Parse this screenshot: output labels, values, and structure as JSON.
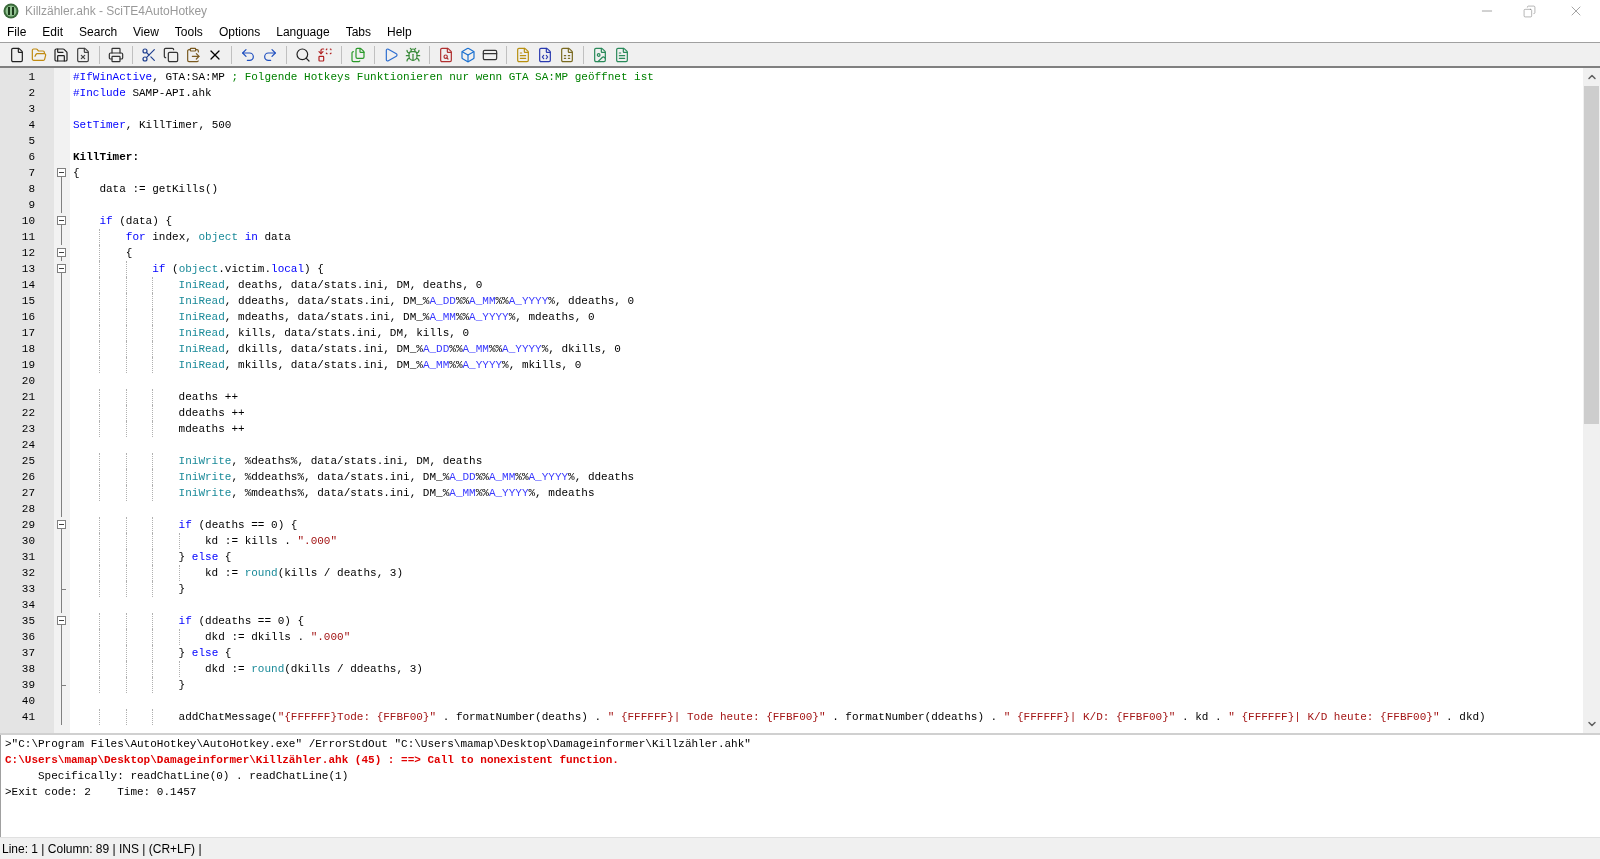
{
  "window": {
    "title": "Killzähler.ahk - SciTE4AutoHotkey"
  },
  "menu": [
    "File",
    "Edit",
    "Search",
    "View",
    "Tools",
    "Options",
    "Language",
    "Tabs",
    "Help"
  ],
  "editor": {
    "lines": [
      {
        "number": "1",
        "kind": "plain",
        "tokens": [
          {
            "kind": "directive",
            "text": "#IfWinActive"
          },
          {
            "kind": "plain",
            "text": ", GTA:SA:MP "
          },
          {
            "kind": "comment",
            "text": "; Folgende Hotkeys Funktionieren nur wenn GTA SA:MP geöffnet ist"
          }
        ]
      },
      {
        "number": "2",
        "kind": "plain",
        "tokens": [
          {
            "kind": "directive",
            "text": "#Include"
          },
          {
            "kind": "plain",
            "text": " SAMP-API.ahk"
          }
        ]
      },
      {
        "number": "3",
        "kind": "plain"
      },
      {
        "number": "4",
        "kind": "plain",
        "tokens": [
          {
            "kind": "keyword",
            "text": "SetTimer"
          },
          {
            "kind": "plain",
            "text": ", KillTimer, 500"
          }
        ]
      },
      {
        "number": "5",
        "kind": "plain"
      },
      {
        "number": "6",
        "kind": "plain",
        "tokens": [
          {
            "kind": "label",
            "text": "KillTimer:"
          }
        ]
      },
      {
        "number": "7",
        "kind": "fold-start",
        "tokens": [
          {
            "kind": "plain",
            "text": "{"
          }
        ]
      },
      {
        "number": "8",
        "kind": "fold-body",
        "tokens": [
          {
            "kind": "plain",
            "text": "    data := getKills()"
          }
        ]
      },
      {
        "number": "9",
        "kind": "fold-body"
      },
      {
        "number": "10",
        "kind": "fold-start",
        "tokens": [
          {
            "kind": "keyword",
            "text": "    if"
          },
          {
            "kind": "plain",
            "text": " (data) {"
          }
        ]
      },
      {
        "number": "11",
        "kind": "fold-body",
        "tokens": [
          {
            "kind": "keyword",
            "text": "        for"
          },
          {
            "kind": "plain",
            "text": " index, "
          },
          {
            "kind": "builtin",
            "text": "object"
          },
          {
            "kind": "keyword",
            "text": " in"
          },
          {
            "kind": "plain",
            "text": " data"
          }
        ]
      },
      {
        "number": "12",
        "kind": "fold-start",
        "tokens": [
          {
            "kind": "plain",
            "text": "        {"
          }
        ]
      },
      {
        "number": "13",
        "kind": "fold-start",
        "tokens": [
          {
            "kind": "keyword",
            "text": "            if"
          },
          {
            "kind": "plain",
            "text": " ("
          },
          {
            "kind": "builtin",
            "text": "object"
          },
          {
            "kind": "plain",
            "text": ".victim."
          },
          {
            "kind": "keyword",
            "text": "local"
          },
          {
            "kind": "plain",
            "text": ") {"
          }
        ]
      },
      {
        "number": "14",
        "kind": "fold-body",
        "tokens": [
          {
            "kind": "builtin",
            "text": "                IniRead"
          },
          {
            "kind": "plain",
            "text": ", deaths, data/stats.ini, DM, deaths, 0"
          }
        ]
      },
      {
        "number": "15",
        "kind": "fold-body",
        "tokens": [
          {
            "kind": "builtin",
            "text": "                IniRead"
          },
          {
            "kind": "plain",
            "text": ", ddeaths, data/stats.ini, DM_%"
          },
          {
            "kind": "variable",
            "text": "A_DD"
          },
          {
            "kind": "plain",
            "text": "%%"
          },
          {
            "kind": "variable",
            "text": "A_MM"
          },
          {
            "kind": "plain",
            "text": "%%"
          },
          {
            "kind": "variable",
            "text": "A_YYYY"
          },
          {
            "kind": "plain",
            "text": "%, ddeaths, 0"
          }
        ]
      },
      {
        "number": "16",
        "kind": "fold-body",
        "tokens": [
          {
            "kind": "builtin",
            "text": "                IniRead"
          },
          {
            "kind": "plain",
            "text": ", mdeaths, data/stats.ini, DM_%"
          },
          {
            "kind": "variable",
            "text": "A_MM"
          },
          {
            "kind": "plain",
            "text": "%%"
          },
          {
            "kind": "variable",
            "text": "A_YYYY"
          },
          {
            "kind": "plain",
            "text": "%, mdeaths, 0"
          }
        ]
      },
      {
        "number": "17",
        "kind": "fold-body",
        "tokens": [
          {
            "kind": "builtin",
            "text": "                IniRead"
          },
          {
            "kind": "plain",
            "text": ", kills, data/stats.ini, DM, kills, 0"
          }
        ]
      },
      {
        "number": "18",
        "kind": "fold-body",
        "tokens": [
          {
            "kind": "builtin",
            "text": "                IniRead"
          },
          {
            "kind": "plain",
            "text": ", dkills, data/stats.ini, DM_%"
          },
          {
            "kind": "variable",
            "text": "A_DD"
          },
          {
            "kind": "plain",
            "text": "%%"
          },
          {
            "kind": "variable",
            "text": "A_MM"
          },
          {
            "kind": "plain",
            "text": "%%"
          },
          {
            "kind": "variable",
            "text": "A_YYYY"
          },
          {
            "kind": "plain",
            "text": "%, dkills, 0"
          }
        ]
      },
      {
        "number": "19",
        "kind": "fold-body",
        "tokens": [
          {
            "kind": "builtin",
            "text": "                IniRead"
          },
          {
            "kind": "plain",
            "text": ", mkills, data/stats.ini, DM_%"
          },
          {
            "kind": "variable",
            "text": "A_MM"
          },
          {
            "kind": "plain",
            "text": "%%"
          },
          {
            "kind": "variable",
            "text": "A_YYYY"
          },
          {
            "kind": "plain",
            "text": "%, mkills, 0"
          }
        ]
      },
      {
        "number": "20",
        "kind": "fold-body"
      },
      {
        "number": "21",
        "kind": "fold-body",
        "tokens": [
          {
            "kind": "plain",
            "text": "                deaths ++"
          }
        ]
      },
      {
        "number": "22",
        "kind": "fold-body",
        "tokens": [
          {
            "kind": "plain",
            "text": "                ddeaths ++"
          }
        ]
      },
      {
        "number": "23",
        "kind": "fold-body",
        "tokens": [
          {
            "kind": "plain",
            "text": "                mdeaths ++"
          }
        ]
      },
      {
        "number": "24",
        "kind": "fold-body"
      },
      {
        "number": "25",
        "kind": "fold-body",
        "tokens": [
          {
            "kind": "builtin",
            "text": "                IniWrite"
          },
          {
            "kind": "plain",
            "text": ", %deaths%, data/stats.ini, DM, deaths"
          }
        ]
      },
      {
        "number": "26",
        "kind": "fold-body",
        "tokens": [
          {
            "kind": "builtin",
            "text": "                IniWrite"
          },
          {
            "kind": "plain",
            "text": ", %ddeaths%, data/stats.ini, DM_%"
          },
          {
            "kind": "variable",
            "text": "A_DD"
          },
          {
            "kind": "plain",
            "text": "%%"
          },
          {
            "kind": "variable",
            "text": "A_MM"
          },
          {
            "kind": "plain",
            "text": "%%"
          },
          {
            "kind": "variable",
            "text": "A_YYYY"
          },
          {
            "kind": "plain",
            "text": "%, ddeaths"
          }
        ]
      },
      {
        "number": "27",
        "kind": "fold-body",
        "tokens": [
          {
            "kind": "builtin",
            "text": "                IniWrite"
          },
          {
            "kind": "plain",
            "text": ", %mdeaths%, data/stats.ini, DM_%"
          },
          {
            "kind": "variable",
            "text": "A_MM"
          },
          {
            "kind": "plain",
            "text": "%%"
          },
          {
            "kind": "variable",
            "text": "A_YYYY"
          },
          {
            "kind": "plain",
            "text": "%, mdeaths"
          }
        ]
      },
      {
        "number": "28",
        "kind": "fold-body"
      },
      {
        "number": "29",
        "kind": "fold-start",
        "tokens": [
          {
            "kind": "keyword",
            "text": "                if"
          },
          {
            "kind": "plain",
            "text": " (deaths == 0) {"
          }
        ]
      },
      {
        "number": "30",
        "kind": "fold-body",
        "tokens": [
          {
            "kind": "plain",
            "text": "                    kd := kills . "
          },
          {
            "kind": "string",
            "text": "\".000\""
          }
        ]
      },
      {
        "number": "31",
        "kind": "fold-body",
        "tokens": [
          {
            "kind": "plain",
            "text": "                } "
          },
          {
            "kind": "keyword",
            "text": "else"
          },
          {
            "kind": "plain",
            "text": " {"
          }
        ]
      },
      {
        "number": "32",
        "kind": "fold-body",
        "tokens": [
          {
            "kind": "plain",
            "text": "                    kd := "
          },
          {
            "kind": "builtin",
            "text": "round"
          },
          {
            "kind": "plain",
            "text": "(kills / deaths, 3)"
          }
        ]
      },
      {
        "number": "33",
        "kind": "fold-end",
        "tokens": [
          {
            "kind": "plain",
            "text": "                }"
          }
        ]
      },
      {
        "number": "34",
        "kind": "fold-body"
      },
      {
        "number": "35",
        "kind": "fold-start",
        "tokens": [
          {
            "kind": "keyword",
            "text": "                if"
          },
          {
            "kind": "plain",
            "text": " (ddeaths == 0) {"
          }
        ]
      },
      {
        "number": "36",
        "kind": "fold-body",
        "tokens": [
          {
            "kind": "plain",
            "text": "                    dkd := dkills . "
          },
          {
            "kind": "string",
            "text": "\".000\""
          }
        ]
      },
      {
        "number": "37",
        "kind": "fold-body",
        "tokens": [
          {
            "kind": "plain",
            "text": "                } "
          },
          {
            "kind": "keyword",
            "text": "else"
          },
          {
            "kind": "plain",
            "text": " {"
          }
        ]
      },
      {
        "number": "38",
        "kind": "fold-body",
        "tokens": [
          {
            "kind": "plain",
            "text": "                    dkd := "
          },
          {
            "kind": "builtin",
            "text": "round"
          },
          {
            "kind": "plain",
            "text": "(dkills / ddeaths, 3)"
          }
        ]
      },
      {
        "number": "39",
        "kind": "fold-end",
        "tokens": [
          {
            "kind": "plain",
            "text": "                }"
          }
        ]
      },
      {
        "number": "40",
        "kind": "fold-body"
      },
      {
        "number": "41",
        "kind": "fold-body",
        "tokens": [
          {
            "kind": "plain",
            "text": "                addChatMessage("
          },
          {
            "kind": "string",
            "text": "\"{FFFFFF}Tode: {FFBF00}\""
          },
          {
            "kind": "plain",
            "text": " . formatNumber(deaths) . "
          },
          {
            "kind": "string",
            "text": "\" {FFFFFF}| Tode heute: {FFBF00}\""
          },
          {
            "kind": "plain",
            "text": " . formatNumber(ddeaths) . "
          },
          {
            "kind": "string",
            "text": "\" {FFFFFF}| K/D: {FFBF00}\""
          },
          {
            "kind": "plain",
            "text": " . kd . "
          },
          {
            "kind": "string",
            "text": "\" {FFFFFF}| K/D heute: {FFBF00}\""
          },
          {
            "kind": "plain",
            "text": " . dkd)"
          }
        ]
      }
    ]
  },
  "output": [
    {
      "kind": "plain",
      "text": ">\"C:\\Program Files\\AutoHotkey\\AutoHotkey.exe\" /ErrorStdOut \"C:\\Users\\mamap\\Desktop\\Damageinformer\\Killzähler.ahk\""
    },
    {
      "kind": "error",
      "text": "C:\\Users\\mamap\\Desktop\\Damageinformer\\Killzähler.ahk (45) : ==> Call to nonexistent function."
    },
    {
      "kind": "plain",
      "text": "     Specifically: readChatLine(0) . readChatLine(1)"
    },
    {
      "kind": "plain",
      "text": ">Exit code: 2    Time: 0.1457"
    }
  ],
  "status_bar": "Line: 1 | Column: 89 | INS | (CR+LF) |"
}
